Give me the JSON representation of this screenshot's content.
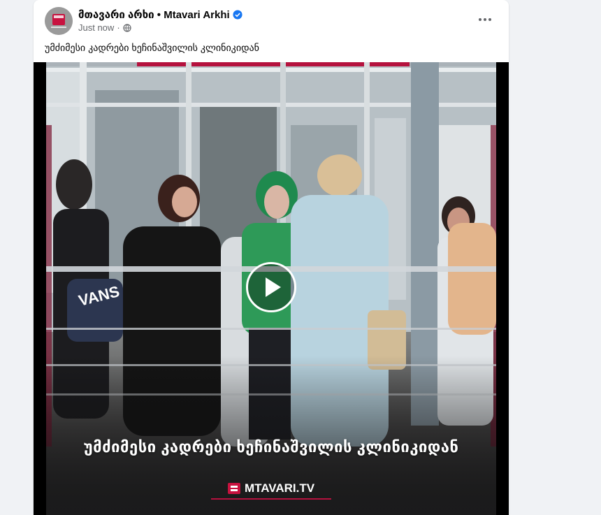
{
  "post": {
    "author": "მთავარი არხი • Mtavari Arkhi",
    "timestamp": "Just now",
    "caption": "უმძიმესი კადრები ხეჩინაშვილის კლინიკიდან"
  },
  "video": {
    "overlay_title": "უმძიმესი კადრები ხეჩინაშვილის კლინიკიდან",
    "brand": "MTAVARI.TV",
    "jacket_text": "VANS"
  },
  "icons": {
    "verified": "verified-badge-icon",
    "privacy": "globe-icon",
    "more": "more-options-icon",
    "play": "play-icon"
  },
  "colors": {
    "brand_red": "#b5123e",
    "verified_blue": "#1877f2"
  }
}
